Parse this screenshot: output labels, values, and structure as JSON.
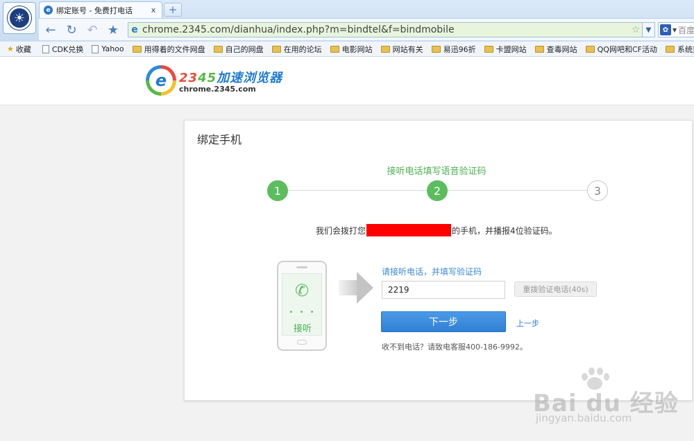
{
  "browser": {
    "tab_title": "绑定账号 - 免费打电话",
    "tab_close": "x",
    "new_tab": "+",
    "url": "chrome.2345.com/dianhua/index.php?m=bindtel&f=bindmobile",
    "search_placeholder": "百度"
  },
  "bookmarks": [
    {
      "label": "收藏",
      "icon": "star-icon"
    },
    {
      "label": "CDK兑换",
      "icon": "page-icon"
    },
    {
      "label": "Yahoo",
      "icon": "page-icon"
    },
    {
      "label": "用得着的文件网盘",
      "icon": "folder-icon"
    },
    {
      "label": "自己的网盘",
      "icon": "folder-icon"
    },
    {
      "label": "在用的论坛",
      "icon": "folder-icon"
    },
    {
      "label": "电影网站",
      "icon": "folder-icon"
    },
    {
      "label": "网站有关",
      "icon": "folder-icon"
    },
    {
      "label": "易迅96折",
      "icon": "folder-icon"
    },
    {
      "label": "卡盟网站",
      "icon": "folder-icon"
    },
    {
      "label": "查毒网站",
      "icon": "folder-icon"
    },
    {
      "label": "QQ网吧和CF活动",
      "icon": "folder-icon"
    },
    {
      "label": "系统封装",
      "icon": "folder-icon"
    }
  ],
  "site": {
    "brand_digits_a": "23",
    "brand_digits_b": "45",
    "brand_name": "加速浏览器",
    "domain": "chrome.2345.com"
  },
  "card": {
    "title": "绑定手机",
    "step_caption": "接听电话填写语音验证码",
    "steps": [
      "1",
      "2",
      "3"
    ],
    "current_step": 2,
    "dial_text_before": "我们会拨打您",
    "dial_text_after": "的手机，并播报4位验证码。",
    "phone_answer_label": "接听",
    "phone_dots": "• • •",
    "form_label": "请接听电话，并填写验证码",
    "code_value": "2219",
    "redial_label": "重拨验证电话(40s)",
    "next_label": "下一步",
    "prev_label": "上一步",
    "help_text": "收不到电话？请致电客服400-186-9992。"
  },
  "watermark": {
    "text": "Bai du 经验",
    "url": "jingyan.baidu.com"
  },
  "colors": {
    "accent_green": "#5cbd5f",
    "accent_blue": "#2f7fd4",
    "redaction": "#ff0000"
  }
}
